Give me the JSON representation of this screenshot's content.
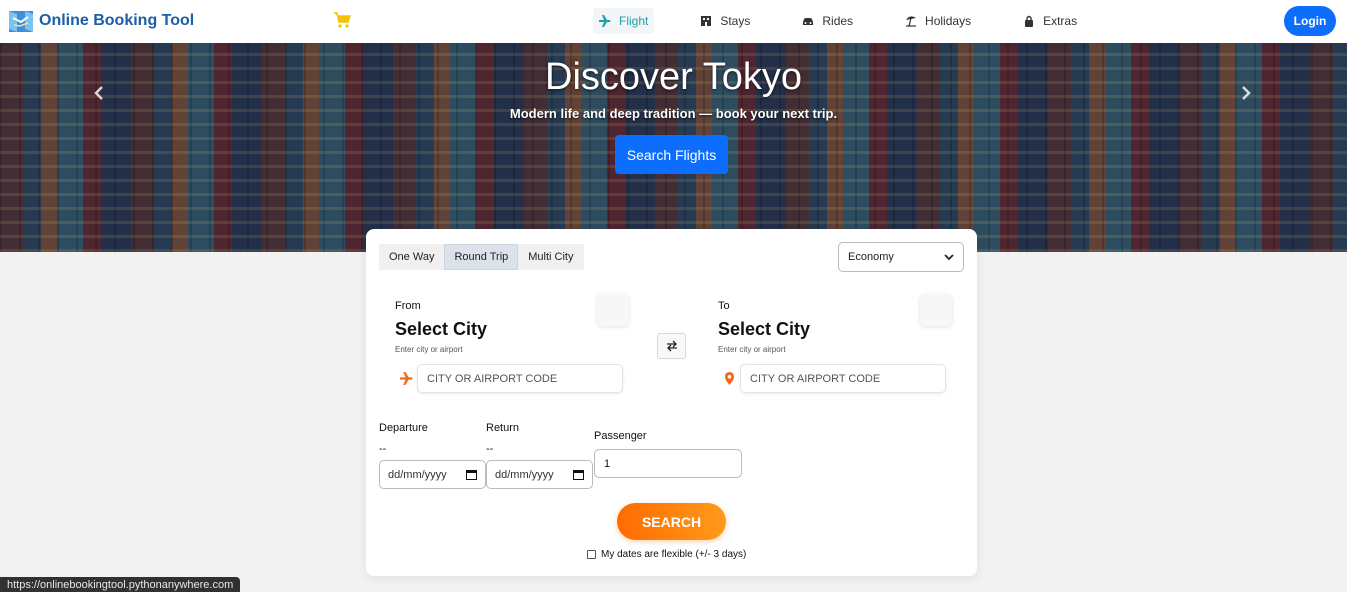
{
  "app": {
    "title": "Online Booking Tool"
  },
  "nav": {
    "items": [
      {
        "label": "Flight",
        "icon": "plane-icon",
        "active": true
      },
      {
        "label": "Stays",
        "icon": "building-icon",
        "active": false
      },
      {
        "label": "Rides",
        "icon": "car-icon",
        "active": false
      },
      {
        "label": "Holidays",
        "icon": "umbrella-beach-icon",
        "active": false
      },
      {
        "label": "Extras",
        "icon": "lock-icon",
        "active": false
      }
    ],
    "login_label": "Login"
  },
  "hero": {
    "title": "Discover Tokyo",
    "subtitle": "Modern life and deep tradition — book your next trip.",
    "button_label": "Search Flights"
  },
  "search": {
    "trip_types": [
      "One Way",
      "Round Trip",
      "Multi City"
    ],
    "selected_trip_type": "Round Trip",
    "cabin_class": "Economy",
    "from": {
      "label": "From",
      "city": "Select City",
      "hint": "Enter city or airport",
      "placeholder": "CITY OR AIRPORT CODE"
    },
    "to": {
      "label": "To",
      "city": "Select City",
      "hint": "Enter city or airport",
      "placeholder": "CITY OR AIRPORT CODE"
    },
    "departure": {
      "label": "Departure",
      "display": "--",
      "placeholder": "dd/mm/yyyy"
    },
    "return": {
      "label": "Return",
      "display": "--",
      "placeholder": "dd/mm/yyyy"
    },
    "passenger": {
      "label": "Passenger",
      "value": "1"
    },
    "search_label": "SEARCH",
    "flexible_label": "My dates are flexible (+/- 3 days)"
  },
  "status_bar": {
    "url": "https://onlinebookingtool.pythonanywhere.com"
  },
  "colors": {
    "primary": "#0d6efd",
    "accent": "#ff7a00",
    "nav_active": "#1aa3a3",
    "brand": "#1a5fa8"
  }
}
